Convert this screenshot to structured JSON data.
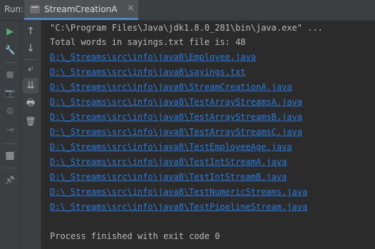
{
  "run_panel": {
    "label": "Run:",
    "tab_title": "StreamCreationA",
    "tab_close": "×"
  },
  "toolbar": {
    "left": [
      {
        "name": "rerun-icon",
        "glyph": "▶",
        "color": "#59a869"
      },
      {
        "name": "wrench-icon",
        "glyph": "🔧",
        "color": "#afb1b3"
      },
      {
        "name": "stop-icon",
        "glyph": "■",
        "color": "#6c6c6c"
      },
      {
        "name": "camera-icon",
        "glyph": "📷",
        "color": "#6c6c6c"
      },
      {
        "name": "restore-layout-icon",
        "glyph": "⚙",
        "color": "#6c6c6c"
      },
      {
        "name": "exit-icon",
        "glyph": "⇥",
        "color": "#6c6c6c"
      },
      {
        "name": "layout-icon",
        "glyph": "▦",
        "color": "#afb1b3"
      },
      {
        "name": "pin-icon",
        "glyph": "📌",
        "color": "#afb1b3"
      }
    ],
    "right": [
      {
        "name": "up-arrow-icon",
        "glyph": "↑"
      },
      {
        "name": "down-arrow-icon",
        "glyph": "↓"
      },
      {
        "name": "soft-wrap-icon",
        "glyph": "⤶"
      },
      {
        "name": "scroll-to-end-icon",
        "glyph": "⇊"
      },
      {
        "name": "print-icon",
        "glyph": "🖶"
      },
      {
        "name": "trash-icon",
        "glyph": "🗑"
      }
    ]
  },
  "console": {
    "command": "\"C:\\Program Files\\Java\\jdk1.8.0_281\\bin\\java.exe\" ...",
    "output": "Total words in sayings.txt file is: 48",
    "links": [
      "D:\\_Streams\\src\\info\\java8\\Employee.java",
      "D:\\_Streams\\src\\info\\java8\\sayings.txt",
      "D:\\_Streams\\src\\info\\java8\\StreamCreationA.java",
      "D:\\_Streams\\src\\info\\java8\\TestArrayStreamsA.java",
      "D:\\_Streams\\src\\info\\java8\\TestArrayStreamsB.java",
      "D:\\_Streams\\src\\info\\java8\\TestArrayStreamsC.java",
      "D:\\_Streams\\src\\info\\java8\\TestEmployeeAge.java",
      "D:\\_Streams\\src\\info\\java8\\TestIntStreamA.java",
      "D:\\_Streams\\src\\info\\java8\\TestIntStreamB.java",
      "D:\\_Streams\\src\\info\\java8\\TestNumericStreams.java",
      "D:\\_Streams\\src\\info\\java8\\TestPipelineStream.java"
    ],
    "exit_message": "Process finished with exit code 0"
  }
}
